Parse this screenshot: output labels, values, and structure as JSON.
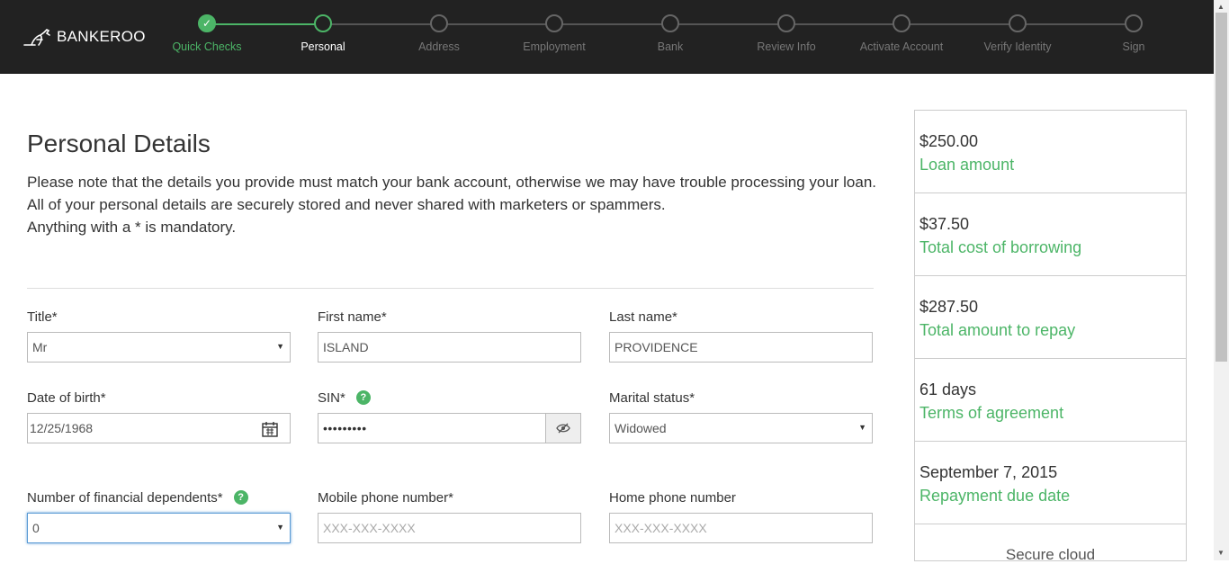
{
  "brand": {
    "name": "BANKEROO"
  },
  "steps": [
    {
      "label": "Quick Checks",
      "state": "done"
    },
    {
      "label": "Personal",
      "state": "active"
    },
    {
      "label": "Address",
      "state": "todo"
    },
    {
      "label": "Employment",
      "state": "todo"
    },
    {
      "label": "Bank",
      "state": "todo"
    },
    {
      "label": "Review Info",
      "state": "todo"
    },
    {
      "label": "Activate Account",
      "state": "todo"
    },
    {
      "label": "Verify Identity",
      "state": "todo"
    },
    {
      "label": "Sign",
      "state": "todo"
    }
  ],
  "page": {
    "title": "Personal Details",
    "intro_line1": "Please note that the details you provide must match your bank account, otherwise we may have trouble processing your loan.",
    "intro_line2": "All of your personal details are securely stored and never shared with marketers or spammers.",
    "intro_line3": "Anything with a * is mandatory."
  },
  "form": {
    "title_label": "Title*",
    "title_value": "Mr",
    "first_label": "First name*",
    "first_value": "ISLAND",
    "last_label": "Last name*",
    "last_value": "PROVIDENCE",
    "dob_label": "Date of birth*",
    "dob_value": "12/25/1968",
    "sin_label": "SIN*",
    "sin_value": "•••••••••",
    "marital_label": "Marital status*",
    "marital_value": "Widowed",
    "dependents_label": "Number of financial dependents*",
    "dependents_value": "0",
    "mobile_label": "Mobile phone number*",
    "mobile_placeholder": "XXX-XXX-XXXX",
    "home_label": "Home phone number",
    "home_placeholder": "XXX-XXX-XXXX",
    "help_glyph": "?"
  },
  "summary": {
    "items": [
      {
        "value": "$250.00",
        "caption": "Loan amount"
      },
      {
        "value": "$37.50",
        "caption": "Total cost of borrowing"
      },
      {
        "value": "$287.50",
        "caption": "Total amount to repay"
      },
      {
        "value": "61 days",
        "caption": "Terms of agreement"
      },
      {
        "value": "September 7, 2015",
        "caption": "Repayment due date"
      }
    ],
    "secure_text": "Secure cloud"
  },
  "colors": {
    "accent": "#4cb567",
    "topbar": "#222222"
  }
}
